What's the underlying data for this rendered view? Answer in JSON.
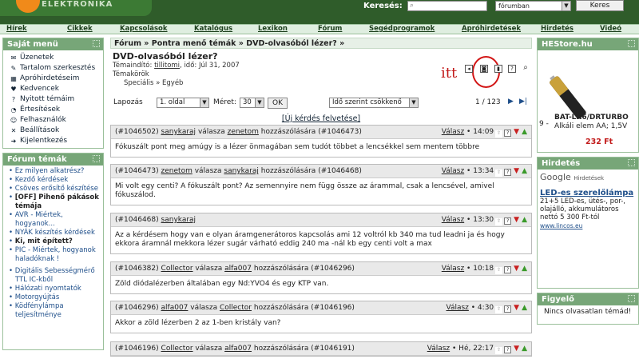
{
  "header": {
    "logo_text": "ELEKTRONIKA",
    "search_label": "Keresés:",
    "search_value": "",
    "search_scope": "fórumban",
    "search_button": "Keres"
  },
  "nav": [
    "Hírek",
    "Cikkek",
    "Kapcsolások",
    "Katalógus",
    "Lexikon",
    "Fórum",
    "Segédprogramok",
    "Apróhirdetések",
    "Hirdetés",
    "Videó"
  ],
  "left": {
    "my_menu_title": "Saját menü",
    "my_menu": [
      {
        "label": "Üzenetek",
        "icon": "envelope-icon",
        "glyph": "✉"
      },
      {
        "label": "Tartalom szerkesztés",
        "icon": "edit-icon",
        "glyph": "✎"
      },
      {
        "label": "Apróhirdetéseim",
        "icon": "ads-icon",
        "glyph": "▦"
      },
      {
        "label": "Kedvencek",
        "icon": "heart-icon",
        "glyph": "♥"
      },
      {
        "label": "Nyitott témáim",
        "icon": "question-icon",
        "glyph": "?"
      },
      {
        "label": "Értesítések",
        "icon": "bell-icon",
        "glyph": "◔"
      },
      {
        "label": "Felhasználók",
        "icon": "users-icon",
        "glyph": "☺"
      },
      {
        "label": "Beállítások",
        "icon": "tools-icon",
        "glyph": "✕"
      },
      {
        "label": "Kijelentkezés",
        "icon": "logout-icon",
        "glyph": "➜"
      }
    ],
    "topics_title": "Fórum témák",
    "topics": [
      "Ez milyen alkatrész?",
      "Kezdő kérdések",
      "Csöves erősítő készítése",
      "[OFF] Pihenő pákások témája",
      "AVR - Miértek, hogyanok...",
      "NYÁK készítés kérdések",
      "Ki, mit épített?",
      "PIC - Miértek, hogyanok haladóknak !",
      "Digitális Sebességmérő TTL IC-kből",
      "Hálózati nyomtatók",
      "Motorgyújtás",
      "Ködfénylámpa teljesítménye"
    ]
  },
  "main": {
    "breadcrumb": "Fórum » Pontra menő témák » DVD-olvasóból lézer? »",
    "title": "DVD-olvasóból lézer?",
    "starter_prefix": "Témaindító:",
    "starter_user": "tillitomi",
    "starter_date": ", idő: Júl 31, 2007",
    "categories_label": "Témakörök",
    "categories": "Speciális » Egyéb",
    "itt_annotation": "itt",
    "pager": {
      "label_paging": "Lapozás",
      "page_select": "1. oldal",
      "size_label": "Méret:",
      "size_value": "30",
      "ok": "OK",
      "order": "Idő szerint csökkenő",
      "page_count": "1 / 123"
    },
    "new_question": "[Új kérdés felvetése]",
    "posts": [
      {
        "id": "(#1046502)",
        "author": "sanykaraj",
        "verb": "válasza",
        "to": "zenetom",
        "suffix": "hozzászólására",
        "ref": "(#1046473)",
        "reply": "Válasz",
        "time": "• 14:09",
        "body": "Fókuszált pont meg amúgy is a lézer önmagában sem tudót többet a lencsékkel sem mentem többre"
      },
      {
        "id": "(#1046473)",
        "author": "zenetom",
        "verb": "válasza",
        "to": "sanykaraj",
        "suffix": "hozzászólására",
        "ref": "(#1046468)",
        "reply": "Válasz",
        "time": "• 13:34",
        "body": "Mi volt egy centi? A fókuszált pont? Az semennyire nem függ össze az árammal, csak a lencsével, amivel fókuszálod."
      },
      {
        "id": "(#1046468)",
        "author": "sanykaraj",
        "verb": "",
        "to": "",
        "suffix": "",
        "ref": "",
        "reply": "Válasz",
        "time": "• 13:30",
        "body": "Az a kérdésem hogy van e olyan áramgenerátoros kapcsolás ami 12 voltról kb 340 ma tud leadni ja és hogy ekkora áramnál mekkora lézer sugár várható eddig 240 ma -nál kb egy centi volt a max"
      },
      {
        "id": "(#1046382)",
        "author": "Collector",
        "verb": "válasza",
        "to": "alfa007",
        "suffix": "hozzászólására",
        "ref": "(#1046296)",
        "reply": "Válasz",
        "time": "• 10:18",
        "body": "Zöld diódalézerben általában egy Nd:YVO4 és egy KTP van."
      },
      {
        "id": "(#1046296)",
        "author": "alfa007",
        "verb": "válasza",
        "to": "Collector",
        "suffix": "hozzászólására",
        "ref": "(#1046196)",
        "reply": "Válasz",
        "time": "• 4:30",
        "body": "Akkor a zöld lézerben 2 az 1-ben kristály van?"
      },
      {
        "id": "(#1046196)",
        "author": "Collector",
        "verb": "válasza",
        "to": "alfa007",
        "suffix": "hozzászólására",
        "ref": "(#1046191)",
        "reply": "Válasz",
        "time": "• Hé, 22:17",
        "body": ""
      }
    ]
  },
  "right": {
    "hestore_title": "HEStore.hu",
    "product_number": "9 -",
    "product_name": "BAT-LR6/DRTURBO",
    "product_desc": "Alkáli elem AA; 1,5V",
    "product_price": "232 Ft",
    "ads_title": "Hirdetés",
    "google_label": "Google",
    "google_suffix": "Hirdetések",
    "ad_title": "LED-es szerelőlámpa",
    "ad_text": "21+5 LED-es, ütés-, por-, olajálló, akkumulátoros nettó 5 300 Ft-tól",
    "ad_link": "www.lincos.eu",
    "watcher_title": "Figyelő",
    "watcher_text": "Nincs olvasatlan témád!"
  },
  "colors": {
    "header": "#2f5c2a",
    "box_head": "#77a678",
    "accent_red": "#c21a1a",
    "price": "#c21a1a"
  }
}
